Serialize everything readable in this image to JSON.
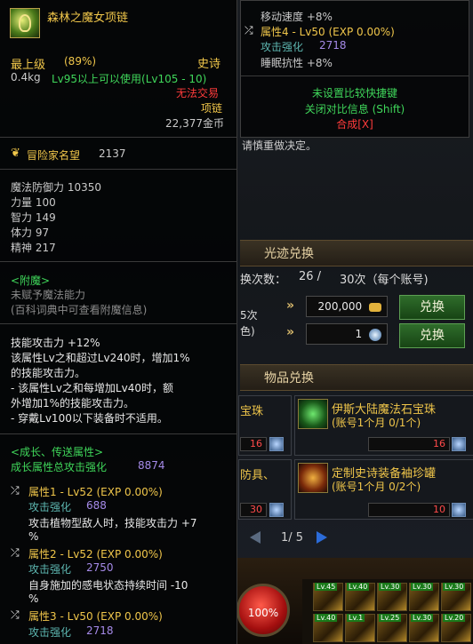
{
  "background": {
    "behind_text_1": "请慎重做决定。",
    "section_light_title": "光迹兑换",
    "exchange_count_label": "换次数：",
    "exchange_count_value": "26 /",
    "exchange_count_limit": "30次（每个账号)",
    "partial_text_1": "5次",
    "partial_text_2": "色)",
    "cost_gold": "200,000",
    "cost_item_qty": "1",
    "exchange_button_label": "兑换",
    "section_item_title": "物品兑换",
    "cards": [
      {
        "title": "宝珠",
        "sub": "",
        "qty": "16"
      },
      {
        "title": "伊斯大陆魔法石宝珠",
        "sub": "(账号1个月 0/1个)",
        "qty": "16"
      },
      {
        "title": "防具、",
        "sub": "",
        "qty": "30"
      },
      {
        "title": "定制史诗装备袖珍罐",
        "sub": "(账号1个月 0/2个)",
        "qty": "10"
      }
    ],
    "pager": "1/ 5",
    "hp_orb": "100%",
    "skill_badges": [
      "Lv.45",
      "Lv.40",
      "Lv.30",
      "Lv.30",
      "Lv.30",
      "Lv.40",
      "Lv.1",
      "Lv.25",
      "Lv.30",
      "Lv.20"
    ]
  },
  "tooltip": {
    "name": "森林之魔女项链",
    "grade": "最上级",
    "grade_pct": "(89%)",
    "rarity": "史诗",
    "weight": "0.4kg",
    "level_req": "Lv95以上可以使用(Lv105 - 10)",
    "trade": "无法交易",
    "slot": "项链",
    "price": "22,377金币",
    "fame_label": "冒险家名望",
    "fame_value": "2137",
    "magic_def": "魔法防御力 10350",
    "stats": [
      "力量 100",
      "智力 149",
      "体力 97",
      "精神 217"
    ],
    "enchant_title": "<附魔>",
    "enchant_lines": [
      "未赋予魔法能力",
      "(百科词典中可查看附魔信息)"
    ],
    "skill_lines": [
      "技能攻击力 +12%",
      "该属性Lv之和超过Lv240时，增加1%",
      "的技能攻击力。",
      "- 该属性Lv之和每增加Lv40时，额",
      "外增加1%的技能攻击力。",
      "- 穿戴Lv100以下装备时不适用。"
    ],
    "growth_title": "<成长、传送属性>",
    "growth_total_label": "成长属性总攻击强化",
    "growth_total_value": "8874",
    "attrs": [
      {
        "head": "属性1 - Lv52 (EXP 0.00%)",
        "atk_label": "攻击强化",
        "atk_value": "688",
        "desc": "攻击植物型敌人时，技能攻击力 +7",
        "desc2": "%"
      },
      {
        "head": "属性2 - Lv52 (EXP 0.00%)",
        "atk_label": "攻击强化",
        "atk_value": "2750",
        "desc": "自身施加的感电状态持续时间 -10",
        "desc2": "%"
      },
      {
        "head": "属性3 - Lv50 (EXP 0.00%)",
        "atk_label": "攻击强化",
        "atk_value": "2718"
      }
    ]
  },
  "tooltip2": {
    "line1": "移动速度 +8%",
    "attr4_head": "属性4 - Lv50 (EXP 0.00%)",
    "attr4_atk_label": "攻击强化",
    "attr4_atk_value": "2718",
    "attr4_extra": "睡眠抗性 +8%",
    "hint1": "未设置比较快捷键",
    "hint2": "关闭对比信息 (Shift)",
    "hint3": "合成[X]"
  },
  "colors": {
    "gold": "#f0c64a",
    "red": "#ff3b3b",
    "green": "#3fd65a",
    "purple": "#a58ae8",
    "teal_label": "#5db6b0"
  }
}
